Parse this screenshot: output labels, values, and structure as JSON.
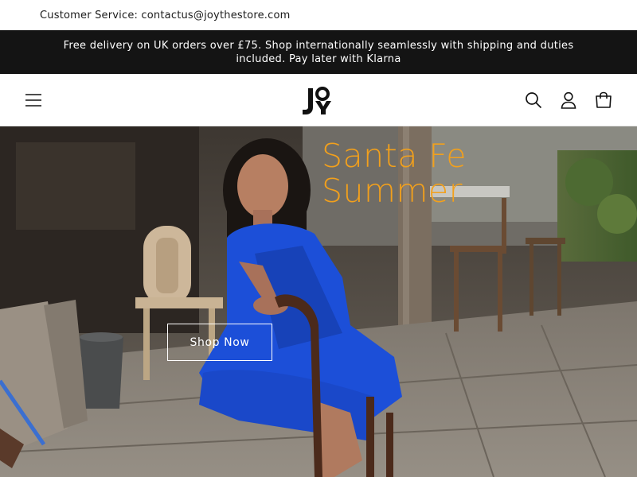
{
  "utility_bar": {
    "customer_service": "Customer Service: contactus@joythestore.com"
  },
  "announcement": {
    "text": "Free delivery on UK orders over £75. Shop internationally seamlessly with shipping and duties included. Pay later with Klarna"
  },
  "header": {
    "logo_text": "JOY",
    "icons": [
      "menu-icon",
      "search-icon",
      "account-icon",
      "cart-icon"
    ]
  },
  "hero": {
    "title_line1": "Santa Fe",
    "title_line2": "Summer",
    "cta_label": "Shop Now",
    "title_color": "#f2a01c",
    "dress_color": "#1c4fd8"
  }
}
